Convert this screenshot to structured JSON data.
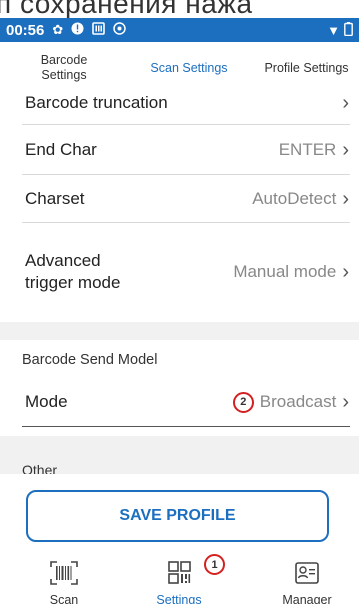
{
  "overlay_text": "п сохранения нажа",
  "status_bar": {
    "time": "00:56"
  },
  "tabs": [
    {
      "label": "Barcode Settings"
    },
    {
      "label": "Scan Settings"
    },
    {
      "label": "Profile Settings"
    }
  ],
  "settings": {
    "barcode_truncation": {
      "label": "Barcode truncation"
    },
    "end_char": {
      "label": "End Char",
      "value": "ENTER"
    },
    "charset": {
      "label": "Charset",
      "value": "AutoDetect"
    },
    "advanced_trigger": {
      "label": "Advanced trigger mode",
      "value": "Manual mode"
    }
  },
  "send_model": {
    "title": "Barcode Send Model",
    "mode": {
      "label": "Mode",
      "value": "Broadcast",
      "badge": "2"
    }
  },
  "other": {
    "title": "Other"
  },
  "save_button": "SAVE PROFILE",
  "bottom_nav": {
    "scan": "Scan",
    "settings": "Settings",
    "settings_badge": "1",
    "manager": "Manager"
  },
  "colors": {
    "accent": "#1c6fbf",
    "annotation": "#d32020",
    "section_bg": "#f1f1f1"
  },
  "icons": [
    "settings-gear-icon",
    "alert-icon",
    "sim-icon",
    "sync-icon",
    "wifi-icon",
    "battery-icon",
    "chevron-right-icon",
    "barcode-icon",
    "qr-code-icon",
    "contact-card-icon"
  ]
}
